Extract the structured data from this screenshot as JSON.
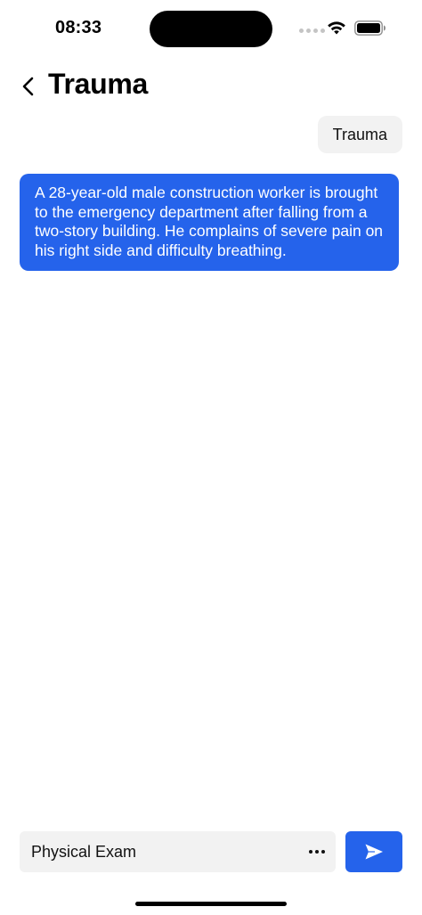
{
  "status_bar": {
    "time": "08:33"
  },
  "header": {
    "title": "Trauma",
    "back_icon": "chevron-left-icon"
  },
  "messages": [
    {
      "role": "user",
      "text": "Trauma"
    },
    {
      "role": "assistant",
      "text": "A 28-year-old male construction worker is brought to the emergency department after falling from a two-story building. He complains of severe pain on his right side and difficulty breathing."
    }
  ],
  "composer": {
    "value": "Physical Exam",
    "more_icon": "more-horizontal-icon",
    "send_icon": "send-icon"
  },
  "colors": {
    "accent": "#2563eb",
    "bubble_gray": "#f2f2f2",
    "background": "#ffffff"
  }
}
